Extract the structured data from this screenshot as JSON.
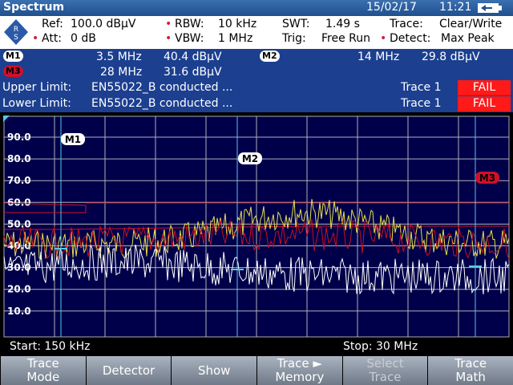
{
  "title": "Spectrum",
  "date": "15/02/17",
  "time": "11:21",
  "settings": {
    "ref_label": "Ref:",
    "ref_value": "100.0 dBµV",
    "att_label": "Att:",
    "att_value": "0 dB",
    "rbw_label": "RBW:",
    "rbw_value": "10 kHz",
    "vbw_label": "VBW:",
    "vbw_value": "1 MHz",
    "swt_label": "SWT:",
    "swt_value": "1.49 s",
    "trig_label": "Trig:",
    "trig_value": "Free Run",
    "trace_label": "Trace:",
    "trace_value": "Clear/Write",
    "detect_label": "Detect:",
    "detect_value": "Max Peak"
  },
  "markers": {
    "m1": {
      "label": "M1",
      "freq": "3.5  MHz",
      "level": "40.4  dBµV"
    },
    "m2": {
      "label": "M2",
      "freq": "14  MHz",
      "level": "29.8  dBµV"
    },
    "m3": {
      "label": "M3",
      "freq": "28  MHz",
      "level": "31.6  dBµV"
    }
  },
  "limits": {
    "upper": {
      "label": "Upper Limit:",
      "name": "EN55022_B conducted ...",
      "trace": "Trace 1",
      "status": "FAIL"
    },
    "lower": {
      "label": "Lower Limit:",
      "name": "EN55022_B conducted ...",
      "trace": "Trace 1",
      "status": "FAIL"
    }
  },
  "y_ticks": [
    "90.0",
    "80.0",
    "70.0",
    "60.0",
    "50.0",
    "40.0",
    "30.0",
    "20.0",
    "10.0"
  ],
  "start": "Start:  150 kHz",
  "stop": "Stop: 30 MHz",
  "softkeys": [
    {
      "line1": "Trace",
      "line2": "Mode",
      "enabled": true
    },
    {
      "line1": "Detector",
      "line2": "",
      "enabled": true
    },
    {
      "line1": "Show",
      "line2": "",
      "enabled": true
    },
    {
      "line1": "Trace ►",
      "line2": "Memory",
      "enabled": true
    },
    {
      "line1": "Select",
      "line2": "Trace",
      "enabled": false
    },
    {
      "line1": "Trace",
      "line2": "Math",
      "enabled": true
    }
  ],
  "colors": {
    "accent": "#1c3f8f",
    "fail": "#ff1a1a",
    "limit": "#d0102a",
    "trace_yellow": "#e8e04a",
    "trace_white": "#ffffff",
    "marker_line": "#58c8e8"
  }
}
